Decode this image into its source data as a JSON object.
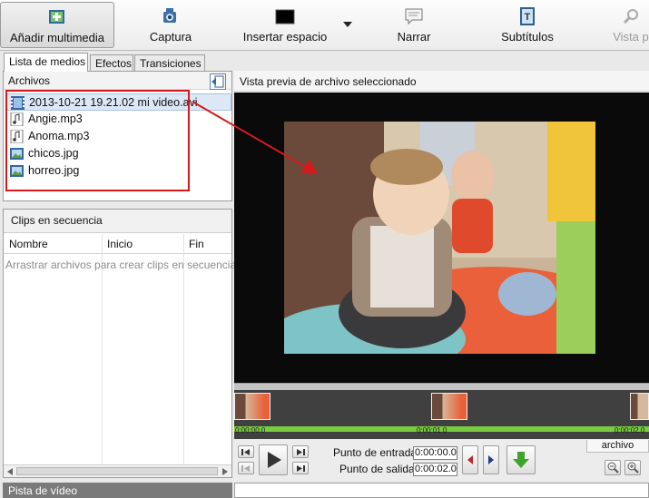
{
  "toolbar": {
    "add_media": "Añadir multimedia",
    "capture": "Captura",
    "insert_space": "Insertar espacio",
    "narrate": "Narrar",
    "subtitles": "Subtítulos",
    "preview": "Vista p"
  },
  "tabs": {
    "media_list": "Lista de medios",
    "effects": "Efectos",
    "transitions": "Transiciones"
  },
  "media": {
    "header": "Archivos",
    "files": [
      {
        "name": "2013-10-21 19.21.02 mi video.avi",
        "icon": "video-file-icon"
      },
      {
        "name": "Angie.mp3",
        "icon": "audio-file-icon"
      },
      {
        "name": "Anoma.mp3",
        "icon": "audio-file-icon"
      },
      {
        "name": "chicos.jpg",
        "icon": "image-file-icon"
      },
      {
        "name": "horreo.jpg",
        "icon": "image-file-icon"
      }
    ]
  },
  "clips": {
    "title": "Clips en secuencia",
    "columns": [
      "Nombre",
      "Inicio",
      "Fin"
    ],
    "hint": "Arrastrar archivos para crear clips en secuencia"
  },
  "track_label": "Pista de vídeo",
  "preview": {
    "title": "Vista previa de archivo seleccionado",
    "timeline_labels": [
      "0:00:00.0",
      "0:00:01.0",
      "0:00:02.0"
    ],
    "entry_label": "Punto de entrada",
    "entry_value": "0:00:00.0",
    "exit_label": "Punto de salida",
    "exit_value": "0:00:02.0",
    "archive_tab": "archivo"
  },
  "colors": {
    "annotation": "#d7191c",
    "timeline_green": "#7acb3f",
    "selection": "#dde8f7"
  }
}
